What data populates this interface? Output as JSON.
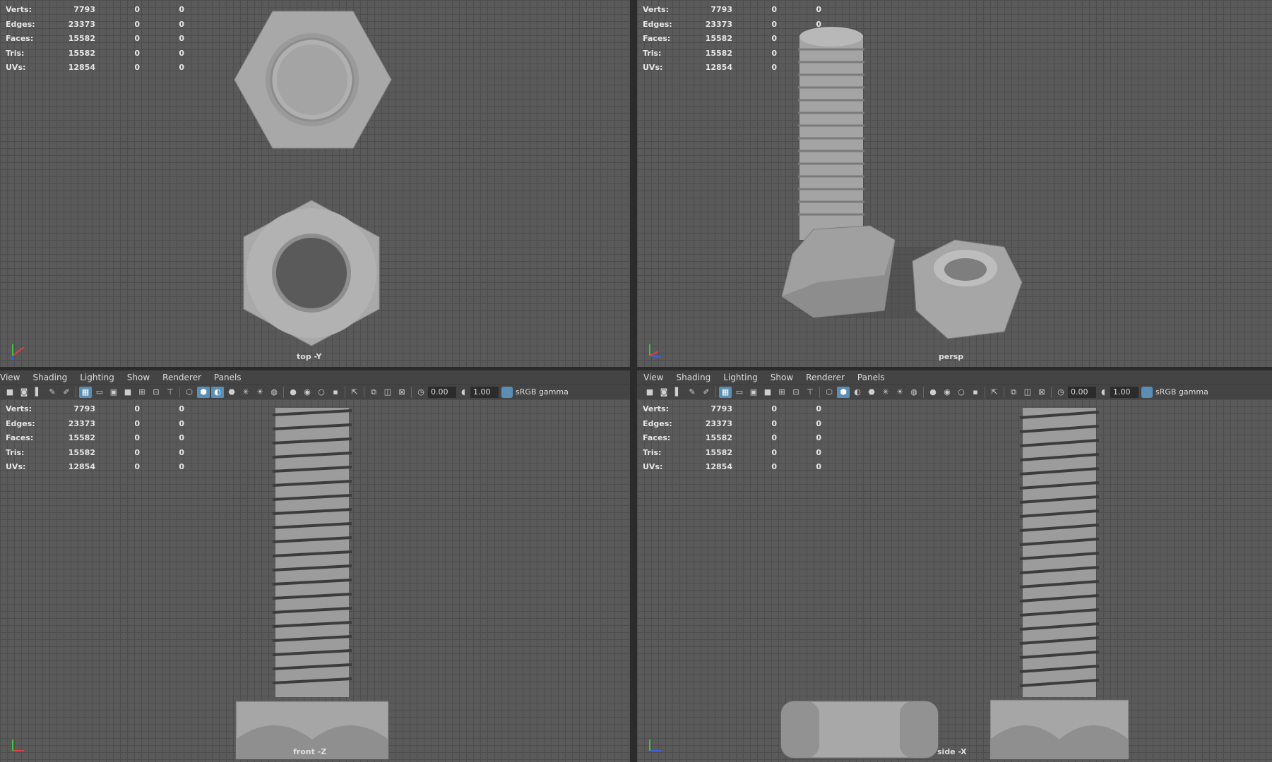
{
  "stats": {
    "rows": [
      {
        "label": "Verts:",
        "value": "7793",
        "a": "0",
        "b": "0"
      },
      {
        "label": "Edges:",
        "value": "23373",
        "a": "0",
        "b": "0"
      },
      {
        "label": "Faces:",
        "value": "15582",
        "a": "0",
        "b": "0"
      },
      {
        "label": "Tris:",
        "value": "15582",
        "a": "0",
        "b": "0"
      },
      {
        "label": "UVs:",
        "value": "12854",
        "a": "0",
        "b": "0"
      }
    ]
  },
  "viewports": {
    "top": {
      "camera": "top -Y"
    },
    "persp": {
      "camera": "persp"
    },
    "front": {
      "camera": "front -Z"
    },
    "side": {
      "camera": "side -X"
    }
  },
  "menu": {
    "items": [
      "View",
      "Shading",
      "Lighting",
      "Show",
      "Renderer",
      "Panels"
    ]
  },
  "toolbar": {
    "exposure": "0.00",
    "gamma": "1.00",
    "colorspace": "sRGB gamma"
  },
  "colors": {
    "accent": "#5a8fb5",
    "bg": "#5a5a5a",
    "grid": "#4d4d4d",
    "model": "#a8a8a8"
  }
}
